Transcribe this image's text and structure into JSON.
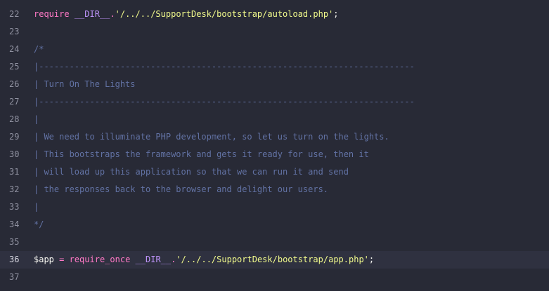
{
  "lines": [
    {
      "n": "22",
      "tokens": [
        {
          "t": "kw",
          "v": "require"
        },
        {
          "t": "plain",
          "v": " "
        },
        {
          "t": "const",
          "v": "__DIR__"
        },
        {
          "t": "op",
          "v": "."
        },
        {
          "t": "str",
          "v": "'/../../SupportDesk/bootstrap/autoload.php'"
        },
        {
          "t": "punct",
          "v": ";"
        }
      ]
    },
    {
      "n": "23",
      "tokens": []
    },
    {
      "n": "24",
      "tokens": [
        {
          "t": "comment",
          "v": "/*"
        }
      ]
    },
    {
      "n": "25",
      "tokens": [
        {
          "t": "comment",
          "v": "|--------------------------------------------------------------------------"
        }
      ]
    },
    {
      "n": "26",
      "tokens": [
        {
          "t": "comment",
          "v": "| Turn On The Lights"
        }
      ]
    },
    {
      "n": "27",
      "tokens": [
        {
          "t": "comment",
          "v": "|--------------------------------------------------------------------------"
        }
      ]
    },
    {
      "n": "28",
      "tokens": [
        {
          "t": "comment",
          "v": "|"
        }
      ]
    },
    {
      "n": "29",
      "tokens": [
        {
          "t": "comment",
          "v": "| We need to illuminate PHP development, so let us turn on the lights."
        }
      ]
    },
    {
      "n": "30",
      "tokens": [
        {
          "t": "comment",
          "v": "| This bootstraps the framework and gets it ready for use, then it"
        }
      ]
    },
    {
      "n": "31",
      "tokens": [
        {
          "t": "comment",
          "v": "| will load up this application so that we can run it and send"
        }
      ]
    },
    {
      "n": "32",
      "tokens": [
        {
          "t": "comment",
          "v": "| the responses back to the browser and delight our users."
        }
      ]
    },
    {
      "n": "33",
      "tokens": [
        {
          "t": "comment",
          "v": "|"
        }
      ]
    },
    {
      "n": "34",
      "tokens": [
        {
          "t": "comment",
          "v": "*/"
        }
      ]
    },
    {
      "n": "35",
      "tokens": []
    },
    {
      "n": "36",
      "active": true,
      "tokens": [
        {
          "t": "var",
          "v": "$app"
        },
        {
          "t": "plain",
          "v": " "
        },
        {
          "t": "op",
          "v": "="
        },
        {
          "t": "plain",
          "v": " "
        },
        {
          "t": "kw",
          "v": "require_once"
        },
        {
          "t": "plain",
          "v": " "
        },
        {
          "t": "const",
          "v": "__DIR__"
        },
        {
          "t": "op",
          "v": "."
        },
        {
          "t": "str",
          "v": "'/../../SupportDesk/bootstrap/app.php'"
        },
        {
          "t": "punct",
          "v": ";"
        }
      ]
    },
    {
      "n": "37",
      "tokens": []
    }
  ],
  "colors": {
    "background": "#282a36",
    "active_line": "#2f3140",
    "keyword": "#ff79c6",
    "constant": "#bd93f9",
    "string": "#f1fa8c",
    "comment": "#6272a4",
    "line_number": "#8f91a0"
  }
}
